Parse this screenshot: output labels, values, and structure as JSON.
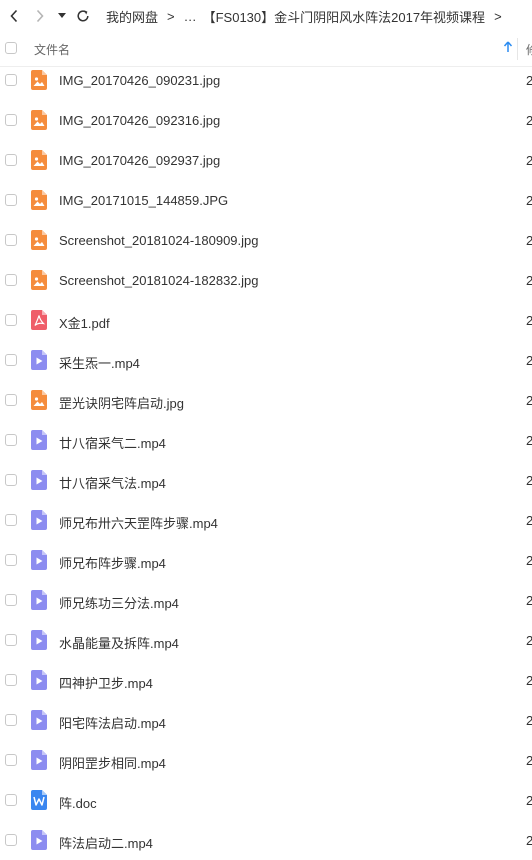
{
  "nav": {
    "back_icon": "chevron-left-icon",
    "forward_icon": "chevron-right-icon",
    "dropdown_icon": "caret-down-icon",
    "refresh_icon": "refresh-icon",
    "breadcrumb": [
      "我的网盘",
      "…",
      "【FS0130】金斗门阴阳风水阵法2017年视频课程"
    ],
    "separator": ">"
  },
  "table": {
    "header_name": "文件名",
    "header_next": "修",
    "sort_icon": "arrow-up-icon",
    "accent_color": "#2b8cf2"
  },
  "files": [
    {
      "name": "IMG_20170426_090231.jpg",
      "type": "image",
      "col2": "2"
    },
    {
      "name": "IMG_20170426_092316.jpg",
      "type": "image",
      "col2": "2"
    },
    {
      "name": "IMG_20170426_092937.jpg",
      "type": "image",
      "col2": "2"
    },
    {
      "name": "IMG_20171015_144859.JPG",
      "type": "image",
      "col2": "2"
    },
    {
      "name": "Screenshot_20181024-180909.jpg",
      "type": "image",
      "col2": "2"
    },
    {
      "name": "Screenshot_20181024-182832.jpg",
      "type": "image",
      "col2": "2"
    },
    {
      "name": "X金1.pdf",
      "type": "pdf",
      "col2": "2"
    },
    {
      "name": "采生炁一.mp4",
      "type": "video",
      "col2": "2"
    },
    {
      "name": "罡光诀阴宅阵启动.jpg",
      "type": "image",
      "col2": "2"
    },
    {
      "name": "廿八宿采气二.mp4",
      "type": "video",
      "col2": "2"
    },
    {
      "name": "廿八宿采气法.mp4",
      "type": "video",
      "col2": "2"
    },
    {
      "name": "师兄布卅六天罡阵步骤.mp4",
      "type": "video",
      "col2": "2"
    },
    {
      "name": "师兄布阵步骤.mp4",
      "type": "video",
      "col2": "2"
    },
    {
      "name": "师兄练功三分法.mp4",
      "type": "video",
      "col2": "2"
    },
    {
      "name": "水晶能量及拆阵.mp4",
      "type": "video",
      "col2": "2"
    },
    {
      "name": "四神护卫步.mp4",
      "type": "video",
      "col2": "2"
    },
    {
      "name": "阳宅阵法启动.mp4",
      "type": "video",
      "col2": "2"
    },
    {
      "name": "阴阳罡步相同.mp4",
      "type": "video",
      "col2": "2"
    },
    {
      "name": "阵.doc",
      "type": "doc",
      "col2": "2"
    },
    {
      "name": "阵法启动二.mp4",
      "type": "video",
      "col2": "2"
    }
  ],
  "icon_colors": {
    "image": "#f58c3c",
    "pdf": "#ef5d69",
    "video": "#8c8cf0",
    "doc": "#3a86f0"
  },
  "icon_names": {
    "image": "image-file-icon",
    "pdf": "pdf-file-icon",
    "video": "video-file-icon",
    "doc": "word-file-icon"
  }
}
